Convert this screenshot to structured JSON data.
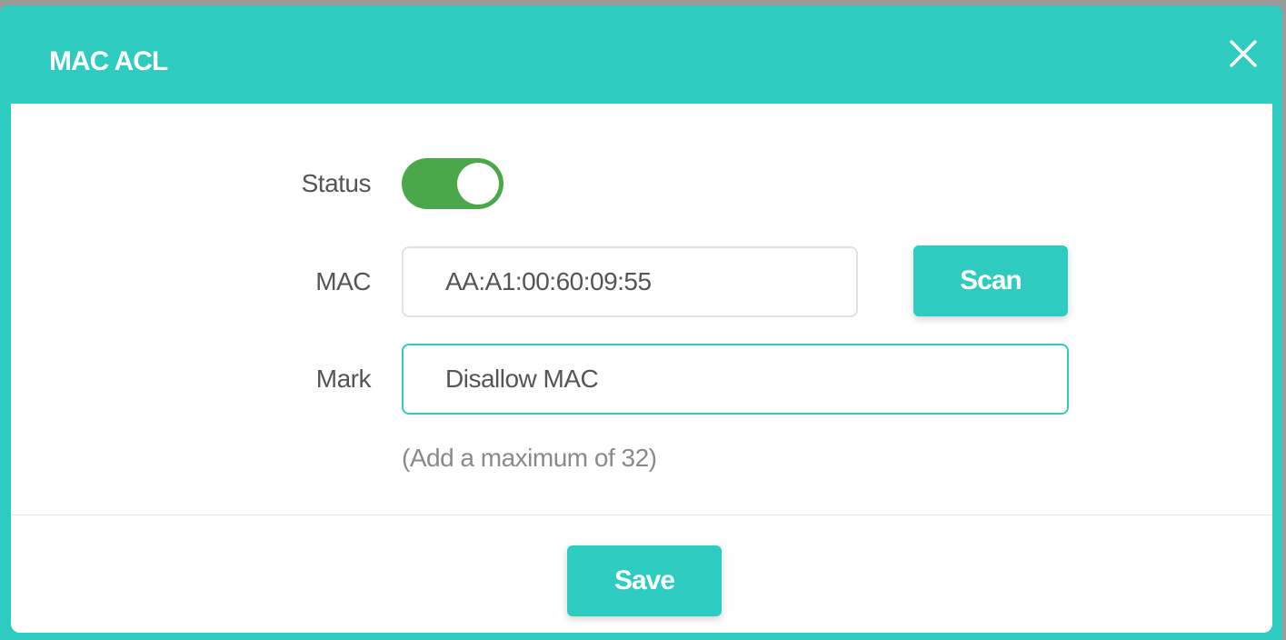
{
  "dialog": {
    "title": "MAC ACL",
    "close_icon": "close-icon"
  },
  "form": {
    "status": {
      "label": "Status",
      "enabled": true
    },
    "mac": {
      "label": "MAC",
      "value": "AA:A1:00:60:09:55"
    },
    "mark": {
      "label": "Mark",
      "value": "Disallow MAC"
    },
    "hint": "(Add a maximum of 32)"
  },
  "buttons": {
    "scan_label": "Scan",
    "save_label": "Save"
  },
  "colors": {
    "accent": "#2ecbc1",
    "toggle_on": "#4aa84a"
  }
}
